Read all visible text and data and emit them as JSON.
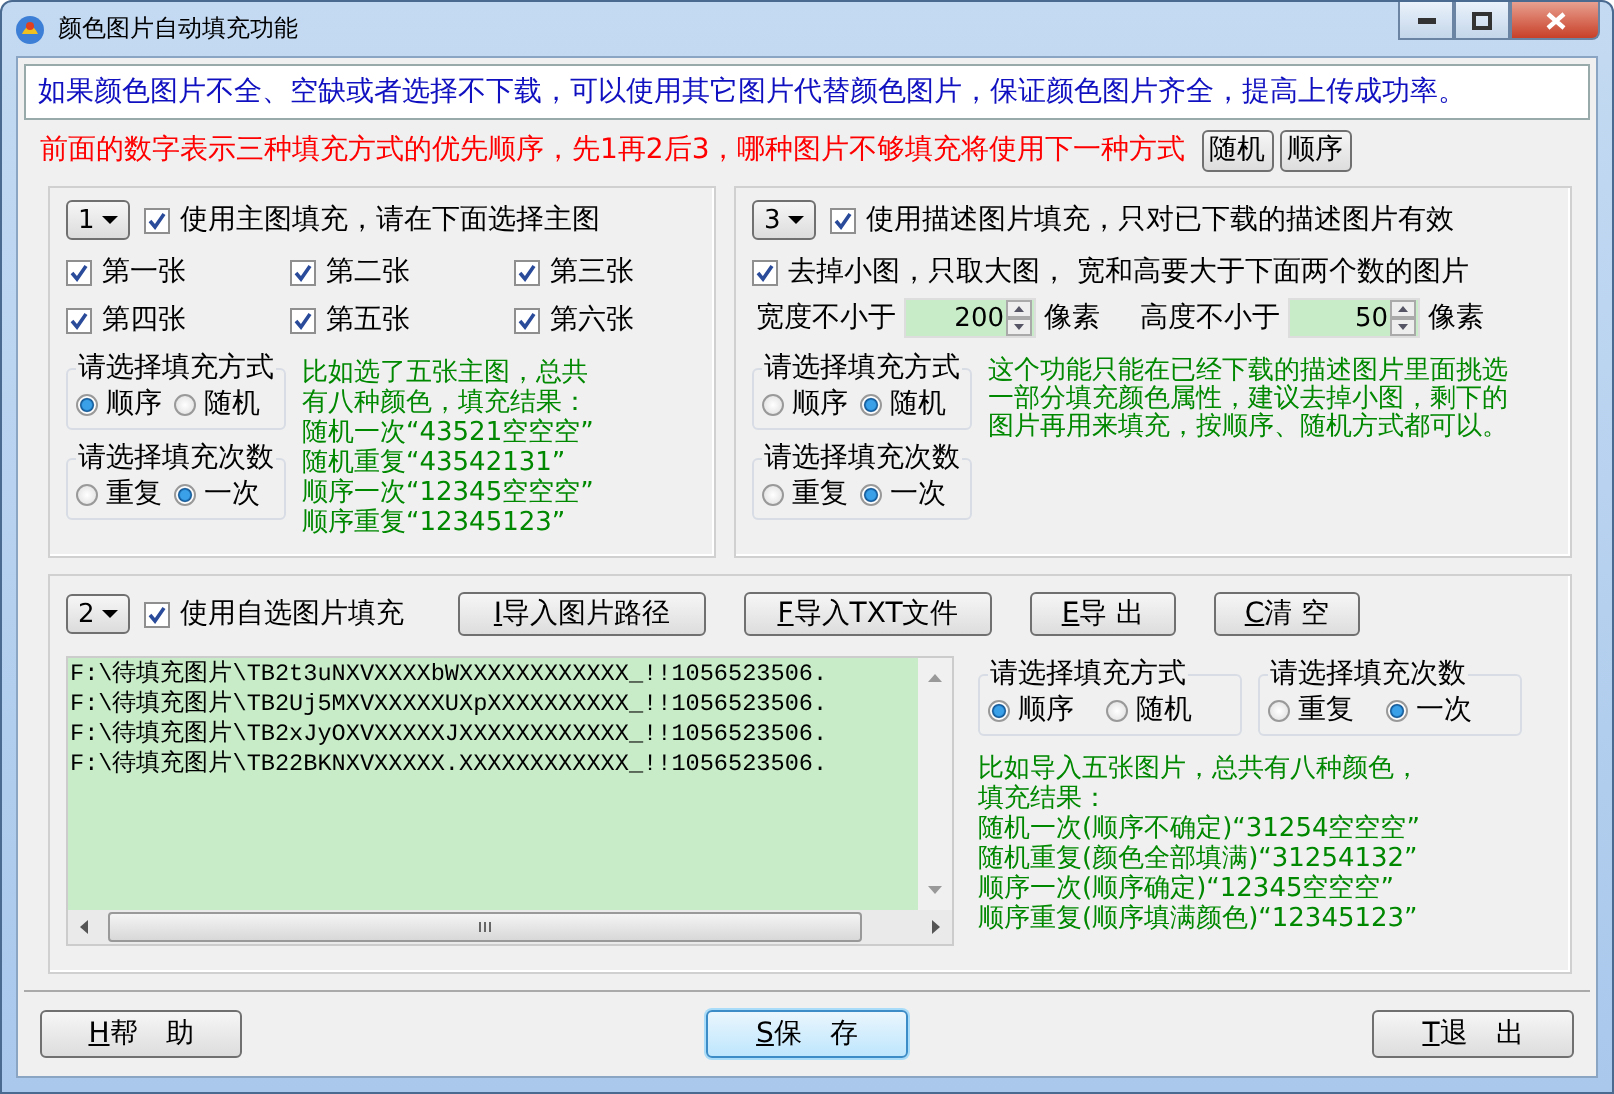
{
  "window": {
    "title": "颜色图片自动填充功能"
  },
  "notice": "如果颜色图片不全、空缺或者选择不下载，可以使用其它图片代替颜色图片，保证颜色图片齐全，提高上传成功率。",
  "priority_hint": {
    "text": "前面的数字表示三种填充方式的优先顺序，先1再2后3，哪种图片不够填充将使用下一种方式",
    "buttons": [
      "随机",
      "顺序"
    ]
  },
  "main_image_panel": {
    "priority": "1",
    "enabled": {
      "label": "使用主图填充，请在下面选择主图",
      "checked": true
    },
    "images": [
      {
        "label": "第一张",
        "checked": true
      },
      {
        "label": "第二张",
        "checked": true
      },
      {
        "label": "第三张",
        "checked": true
      },
      {
        "label": "第四张",
        "checked": true
      },
      {
        "label": "第五张",
        "checked": true
      },
      {
        "label": "第六张",
        "checked": true
      }
    ],
    "fill_mode": {
      "title": "请选择填充方式",
      "options": [
        {
          "label": "顺序",
          "selected": true
        },
        {
          "label": "随机",
          "selected": false
        }
      ]
    },
    "fill_count": {
      "title": "请选择填充次数",
      "options": [
        {
          "label": "重复",
          "selected": false
        },
        {
          "label": "一次",
          "selected": true
        }
      ]
    },
    "example": [
      "比如选了五张主图，总共",
      "有八种颜色，填充结果：",
      "随机一次“43521空空空”",
      "随机重复“43542131”",
      "顺序一次“12345空空空”",
      "顺序重复“12345123”"
    ]
  },
  "description_panel": {
    "priority": "3",
    "enabled": {
      "label": "使用描述图片填充，只对已下载的描述图片有效",
      "checked": true
    },
    "remove_small": {
      "label": "去掉小图，只取大图， 宽和高要大于下面两个数的图片",
      "checked": true
    },
    "sizes": [
      {
        "label": "宽度不小于",
        "value": "200",
        "unit": "像素"
      },
      {
        "label": "高度不小于",
        "value": "50",
        "unit": "像素"
      }
    ],
    "fill_mode": {
      "title": "请选择填充方式",
      "options": [
        {
          "label": "顺序",
          "selected": false
        },
        {
          "label": "随机",
          "selected": true
        }
      ]
    },
    "fill_count": {
      "title": "请选择填充次数",
      "options": [
        {
          "label": "重复",
          "selected": false
        },
        {
          "label": "一次",
          "selected": true
        }
      ]
    },
    "note": "这个功能只能在已经下载的描述图片里面挑选一部分填充颜色属性，建议去掉小图，剩下的图片再用来填充，按顺序、随机方式都可以。"
  },
  "custom_panel": {
    "priority": "2",
    "enabled": {
      "label": "使用自选图片填充",
      "checked": true
    },
    "buttons": [
      "I导入图片路径",
      "F导入TXT文件",
      "E导 出",
      "C清 空"
    ],
    "files": [
      "F:\\待填充图片\\TB2t3uNXVXXXXbWXXXXXXXXXXXX_!!1056523506.",
      "F:\\待填充图片\\TB2Uj5MXVXXXXXUXpXXXXXXXXXX_!!1056523506.",
      "F:\\待填充图片\\TB2xJyOXVXXXXXJXXXXXXXXXXXX_!!1056523506.",
      "F:\\待填充图片\\TB22BKNXVXXXXX.XXXXXXXXXXXX_!!1056523506."
    ],
    "fill_mode": {
      "title": "请选择填充方式",
      "options": [
        {
          "label": "顺序",
          "selected": true
        },
        {
          "label": "随机",
          "selected": false
        }
      ]
    },
    "fill_count": {
      "title": "请选择填充次数",
      "options": [
        {
          "label": "重复",
          "selected": false
        },
        {
          "label": "一次",
          "selected": true
        }
      ]
    },
    "example": [
      "比如导入五张图片，总共有八种颜色，",
      "填充结果：",
      "随机一次(顺序不确定)“31254空空空”",
      "随机重复(颜色全部填满)“31254132”",
      "顺序一次(顺序确定)“12345空空空”",
      "顺序重复(顺序填满颜色)“12345123”"
    ]
  },
  "footer_buttons": [
    {
      "label": "H帮　助",
      "focused": false
    },
    {
      "label": "S保　存",
      "focused": true
    },
    {
      "label": "T退　出",
      "focused": false
    }
  ]
}
